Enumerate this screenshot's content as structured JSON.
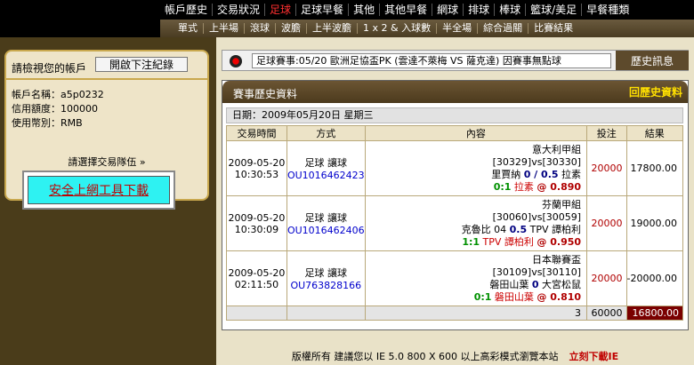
{
  "top_menu": [
    "帳戶歷史",
    "交易狀況",
    "足球",
    "足球早餐",
    "其他",
    "其他早餐",
    "網球",
    "排球",
    "棒球",
    "籃球/美足",
    "早餐種類"
  ],
  "top_menu_active": "足球",
  "sub_menu": [
    "單式",
    "上半場",
    "滾球",
    "波膽",
    "上半波膽",
    "1 x 2 & 入球數",
    "半全場",
    "綜合過關",
    "比賽結果"
  ],
  "account": {
    "heading": "請檢視您的帳戶",
    "open_bets_button": "開啟下注紀錄",
    "name_label": "帳戶名稱：",
    "name": "a5p0232",
    "credit_label": "信用額度：",
    "credit": "100000",
    "currency_label": "使用幣別：",
    "currency": "RMB",
    "select_team_link": "請選擇交易隊伍 »"
  },
  "download_tool": "安全上網工具下載",
  "ticker": {
    "text": "足球賽事:05/20 歐洲足協盃PK (雲達不萊梅 VS 薩克達) 因賽事無點球",
    "history_button": "歷史訊息"
  },
  "panel": {
    "title": "賽事歷史資料",
    "back_link": "回歷史資料",
    "date_line": "日期：2009年05月20日 星期三"
  },
  "table": {
    "headers": [
      "交易時間",
      "方式",
      "內容",
      "投注",
      "結果"
    ],
    "rows": [
      {
        "date": "2009-05-20",
        "time": "10:30:53",
        "type": "足球 讓球",
        "ticket": "OU1016462423",
        "league": "意大利甲組",
        "ids": "[30329]vs[30330]",
        "home": "里賈納",
        "hcap": "0 / 0.5",
        "away": "拉素",
        "score": "0:1",
        "pick": "拉素",
        "odds": "@ 0.890",
        "stake": "20000",
        "result": "17800.00"
      },
      {
        "date": "2009-05-20",
        "time": "10:30:09",
        "type": "足球 讓球",
        "ticket": "OU1016462406",
        "league": "芬蘭甲組",
        "ids": "[30060]vs[30059]",
        "home": "克魯比 04",
        "hcap": "0.5",
        "away": "TPV 譚柏利",
        "score": "1:1",
        "pick": "TPV 譚柏利",
        "odds": "@ 0.950",
        "stake": "20000",
        "result": "19000.00"
      },
      {
        "date": "2009-05-20",
        "time": "02:11:50",
        "type": "足球 讓球",
        "ticket": "OU763828166",
        "league": "日本聯賽盃",
        "ids": "[30109]vs[30110]",
        "home": "磐田山葉",
        "hcap": "0",
        "away": "大宮松鼠",
        "score": "0:1",
        "pick": "磐田山葉",
        "odds": "@ 0.810",
        "stake": "20000",
        "result": "-20000.00"
      }
    ],
    "total_count": "3",
    "total_stake": "60000",
    "total_result": "16800.00"
  },
  "footer": {
    "text": "版權所有 建議您以 IE 5.0 800 X 600 以上高彩模式瀏覽本站",
    "download_link": "立刻下載IE"
  }
}
